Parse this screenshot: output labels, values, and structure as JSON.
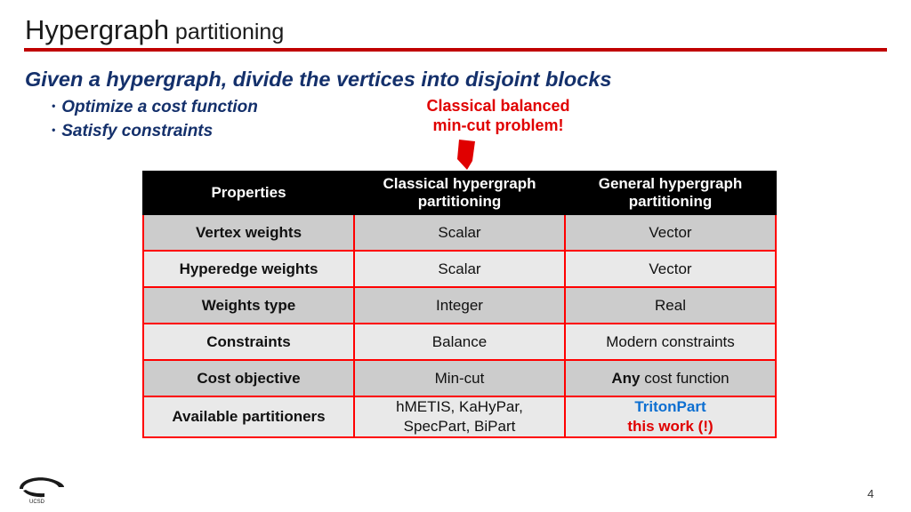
{
  "slide": {
    "title_main": "Hypergraph",
    "title_sub": " partitioning",
    "headline": "Given a hypergraph, divide the vertices into disjoint blocks",
    "bullets": [
      "Optimize a cost function",
      "Satisfy constraints"
    ],
    "bullet_marker": "•",
    "callout_line1": "Classical balanced",
    "callout_line2": "min-cut problem!",
    "page_number": "4",
    "logo_text": "UCSD",
    "accent_red": "#ff0000",
    "rule_red": "#c00000",
    "callout_red": "#e00000",
    "headline_blue": "#14306b",
    "link_blue": "#0d6fd1"
  },
  "table": {
    "headers": [
      "Properties",
      "Classical hypergraph partitioning",
      "General hypergraph partitioning"
    ],
    "rows": [
      {
        "property": "Vertex weights",
        "classical": "Scalar",
        "general": "Vector"
      },
      {
        "property": "Hyperedge weights",
        "classical": "Scalar",
        "general": "Vector"
      },
      {
        "property": "Weights type",
        "classical": "Integer",
        "general": "Real"
      },
      {
        "property": "Constraints",
        "classical": "Balance",
        "general": "Modern constraints"
      },
      {
        "property": "Cost objective",
        "classical": "Min-cut",
        "general_bold": "Any",
        "general_rest": " cost function"
      },
      {
        "property": "Available partitioners",
        "classical_line1": "hMETIS, KaHyPar,",
        "classical_line2": "SpecPart, BiPart",
        "general_line1": "TritonPart",
        "general_line2": "this work (!)"
      }
    ]
  }
}
